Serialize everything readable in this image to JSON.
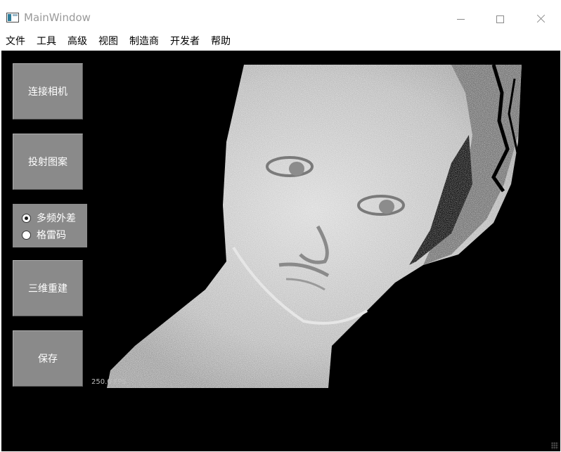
{
  "window": {
    "title": "MainWindow",
    "controls": [
      "minimize",
      "maximize",
      "close"
    ]
  },
  "menubar": {
    "items": [
      "文件",
      "工具",
      "高级",
      "视图",
      "制造商",
      "开发者",
      "帮助"
    ]
  },
  "sidebar": {
    "connect_camera_label": "连接相机",
    "project_pattern_label": "投射图案",
    "radio_options": [
      {
        "label": "多频外差",
        "checked": true
      },
      {
        "label": "格雷码",
        "checked": false
      }
    ],
    "reconstruct_label": "三维重建",
    "save_label": "保存"
  },
  "viewer": {
    "fps_text": "250.0 FPS",
    "image_description_icon": "depth-face-image"
  },
  "colors": {
    "canvas_bg": "#000000",
    "button_bg": "#8a8a8a",
    "button_text": "#ffffff"
  }
}
